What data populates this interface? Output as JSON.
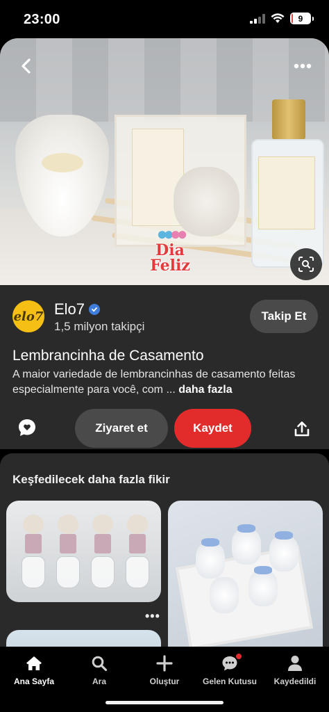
{
  "status_bar": {
    "time": "23:00",
    "battery": "9",
    "battery_level": 0.09,
    "icons": [
      "signal-icon",
      "wifi-icon",
      "battery-icon"
    ]
  },
  "pin": {
    "watermark": "Dia Feliz",
    "actions": {
      "back_icon": "chevron-left-icon",
      "more_icon": "more-horizontal-icon",
      "lens_icon": "visual-search-icon"
    }
  },
  "profile": {
    "avatar_text": "elo7",
    "name": "Elo7",
    "followers": "1,5 milyon takipçi",
    "follow_label": "Takip Et"
  },
  "details": {
    "title": "Lembrancinha de Casamento",
    "description": "A maior variedade de lembrancinhas de casamento feitas especialmente para você, com ... ",
    "more_label": "daha fazla"
  },
  "action_bar": {
    "visit_label": "Ziyaret et",
    "save_label": "Kaydet",
    "comment_icon": "comment-icon",
    "share_icon": "share-icon"
  },
  "more_ideas": {
    "title": "Keşfedilecek daha fazla fikir",
    "card_more": "•••"
  },
  "tab_bar": {
    "items": [
      {
        "label": "Ana Sayfa",
        "icon": "home-icon",
        "active": true
      },
      {
        "label": "Ara",
        "icon": "search-icon",
        "active": false
      },
      {
        "label": "Oluştur",
        "icon": "plus-icon",
        "active": false
      },
      {
        "label": "Gelen Kutusu",
        "icon": "chat-icon",
        "active": false,
        "badge": true
      },
      {
        "label": "Kaydedildi",
        "icon": "profile-icon",
        "active": false
      }
    ]
  },
  "colors": {
    "background": "#000000",
    "panel": "#2a2a2a",
    "save_red": "#e22c2c",
    "secondary_button": "#4a4a4a",
    "avatar_yellow": "#f5c013",
    "verified_blue": "#3e7dd9"
  }
}
